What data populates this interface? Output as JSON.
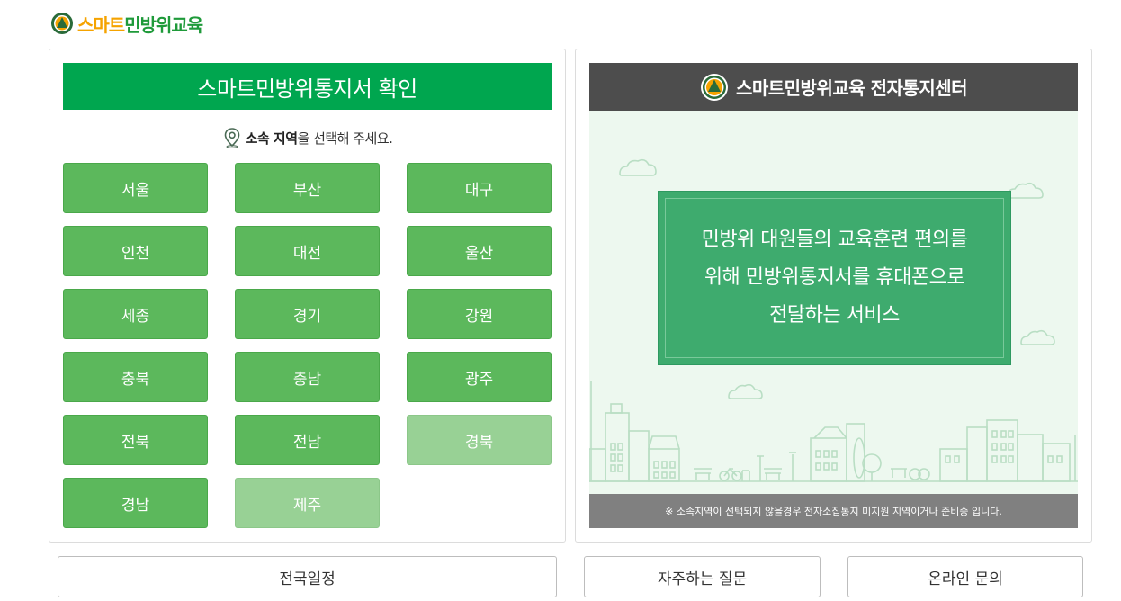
{
  "logo": {
    "text_yellow": "스마트",
    "text_green": "민방위교육"
  },
  "left_panel": {
    "title": "스마트민방위통지서 확인",
    "prompt_bold": "소속 지역",
    "prompt_rest": "을 선택해 주세요.",
    "regions": [
      {
        "label": "서울",
        "enabled": true
      },
      {
        "label": "부산",
        "enabled": true
      },
      {
        "label": "대구",
        "enabled": true
      },
      {
        "label": "인천",
        "enabled": true
      },
      {
        "label": "대전",
        "enabled": true
      },
      {
        "label": "울산",
        "enabled": true
      },
      {
        "label": "세종",
        "enabled": true
      },
      {
        "label": "경기",
        "enabled": true
      },
      {
        "label": "강원",
        "enabled": true
      },
      {
        "label": "충북",
        "enabled": true
      },
      {
        "label": "충남",
        "enabled": true
      },
      {
        "label": "광주",
        "enabled": true
      },
      {
        "label": "전북",
        "enabled": true
      },
      {
        "label": "전남",
        "enabled": true
      },
      {
        "label": "경북",
        "enabled": false
      },
      {
        "label": "경남",
        "enabled": true
      },
      {
        "label": "제주",
        "enabled": false
      }
    ]
  },
  "right_panel": {
    "title": "스마트민방위교육 전자통지센터",
    "message_lines": [
      "민방위 대원들의 교육훈련 편의를",
      "위해 민방위통지서를 휴대폰으로",
      "전달하는 서비스"
    ],
    "notice": "※ 소속지역이 선택되지 않을경우 전자소집통지 미지원 지역이거나 준비중 입니다."
  },
  "bottom_buttons": [
    "전국일정",
    "자주하는 질문",
    "온라인 문의"
  ],
  "colors": {
    "primary_green": "#00a64f",
    "button_green": "#5cb85c",
    "button_disabled": "#98d195",
    "header_dark": "#4d4d4d",
    "message_green": "#3eab6e",
    "illustration_bg": "#edf8ef",
    "logo_yellow": "#f5a300"
  },
  "icons": [
    "civil-defense-logo-icon",
    "location-pin-icon",
    "cloud-icon",
    "city-skyline-illustration"
  ]
}
